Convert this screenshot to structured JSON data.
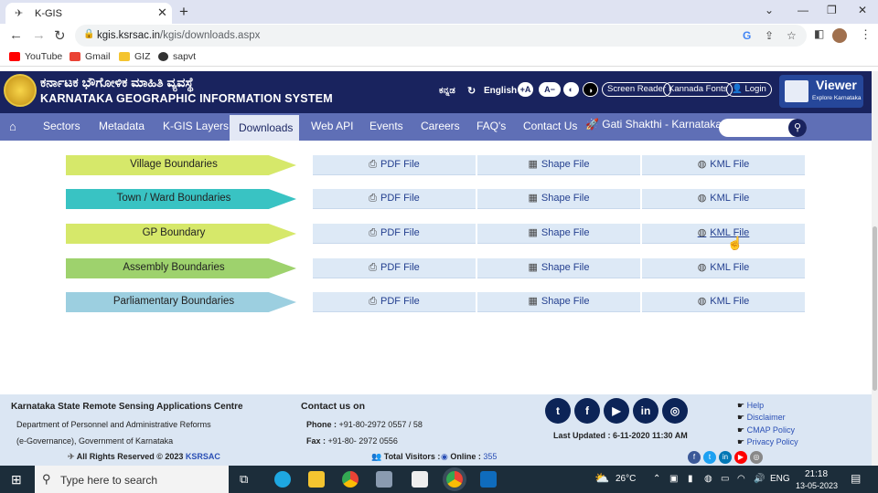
{
  "browser": {
    "tab_title": "K-GIS",
    "url_host": "kgis.ksrsac.in",
    "url_path": "/kgis/downloads.aspx",
    "bookmarks": [
      {
        "label": "YouTube",
        "color": "#ff0000"
      },
      {
        "label": "Gmail",
        "color": "#ea4335"
      },
      {
        "label": "GIZ",
        "color": "#f4c430"
      },
      {
        "label": "sapvt",
        "color": "#333333"
      }
    ]
  },
  "header": {
    "kannada_title": "ಕರ್ನಾಟಕ ಭೌಗೋಳಿಕ ಮಾಹಿತಿ ವ್ಯವಸ್ಥೆ",
    "english_title": "KARNATAKA GEOGRAPHIC INFORMATION SYSTEM",
    "lang_kannada": "ಕನ್ನಡ",
    "lang_english": "English",
    "font_inc": "A",
    "font_dec": "A",
    "screen_reader": "Screen Reader",
    "kannada_fonts": "Kannada Fonts",
    "login": "Login",
    "viewer_title": "Viewer",
    "viewer_sub": "Explore Karnataka"
  },
  "nav": {
    "items": [
      "Sectors",
      "Metadata",
      "K-GIS Layers",
      "Downloads",
      "Web API",
      "Events",
      "Careers",
      "FAQ's",
      "Contact Us"
    ],
    "active": "Downloads",
    "gati": "Gati Shakthi - Karnataka"
  },
  "downloads": {
    "pdf_label": "PDF File",
    "shape_label": "Shape File",
    "kml_label": "KML File",
    "rows": [
      {
        "name": "Village Boundaries",
        "color": "#d6e86a"
      },
      {
        "name": "Town / Ward Boundaries",
        "color": "#39c3c3"
      },
      {
        "name": "GP Boundary",
        "color": "#d6e86a"
      },
      {
        "name": "Assembly Boundaries",
        "color": "#9ed26d"
      },
      {
        "name": "Parliamentary Boundaries",
        "color": "#9ccfe0"
      }
    ]
  },
  "footer": {
    "org": "Karnataka State Remote Sensing Applications Centre",
    "dept1": "Department of Personnel and Administrative Reforms",
    "dept2": "(e-Governance), Government of Karnataka",
    "rights_prefix": "All Rights Reserved © 2023",
    "rights_org": "KSRSAC",
    "contact_title": "Contact us on",
    "phone_label": "Phone :",
    "phone": "+91-80-2972 0557 / 58",
    "fax_label": "Fax :",
    "fax": "+91-80- 2972 0556",
    "visitors_label": "Total Visitors :",
    "online_label": "Online :",
    "online_count": "355",
    "last_updated": "Last Updated : 6-11-2020 11:30 AM",
    "links": [
      "Help",
      "Disclaimer",
      "CMAP Policy",
      "Privacy Policy"
    ],
    "social": [
      "t",
      "f",
      "▶",
      "in",
      "◎"
    ]
  },
  "taskbar": {
    "search_placeholder": "Type here to search",
    "temperature": "26°C",
    "lang": "ENG",
    "time": "21:18",
    "date": "13-05-2023"
  }
}
